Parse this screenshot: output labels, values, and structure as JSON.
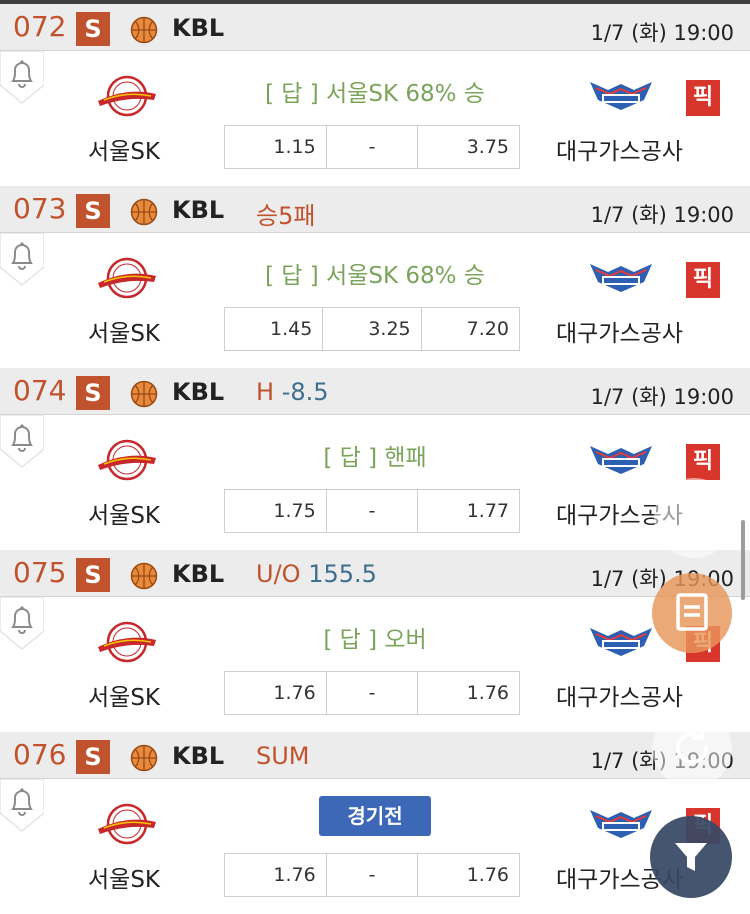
{
  "games": [
    {
      "number": "072",
      "badge": "S",
      "league": "KBL",
      "tag_a": "",
      "tag_b": "",
      "date": "1/7 (화)  19:00",
      "result": "[ 답 ]  서울SK 68% 승",
      "home": "서울SK",
      "away": "대구가스공사",
      "pick": "픽",
      "odds": [
        "1.15",
        "-",
        "3.75"
      ]
    },
    {
      "number": "073",
      "badge": "S",
      "league": "KBL",
      "tag_a": "승5패",
      "tag_b": "",
      "date": "1/7 (화)  19:00",
      "result": "[ 답 ]  서울SK 68% 승",
      "home": "서울SK",
      "away": "대구가스공사",
      "pick": "픽",
      "odds": [
        "1.45",
        "3.25",
        "7.20"
      ]
    },
    {
      "number": "074",
      "badge": "S",
      "league": "KBL",
      "tag_a": "H",
      "tag_b": "-8.5",
      "date": "1/7 (화)  19:00",
      "result": "[ 답 ] 핸패",
      "home": "서울SK",
      "away": "대구가스공사",
      "pick": "픽",
      "odds": [
        "1.75",
        "-",
        "1.77"
      ]
    },
    {
      "number": "075",
      "badge": "S",
      "league": "KBL",
      "tag_a": "U/O",
      "tag_b": "155.5",
      "date": "1/7 (화)  19:00",
      "result": "[ 답 ] 오버",
      "home": "서울SK",
      "away": "대구가스공사",
      "pick": "픽",
      "odds": [
        "1.76",
        "-",
        "1.76"
      ]
    },
    {
      "number": "076",
      "badge": "S",
      "league": "KBL",
      "tag_a": "SUM",
      "tag_b": "",
      "date": "1/7 (화)  19:00",
      "button": "경기전",
      "home": "서울SK",
      "away": "대구가스공사",
      "pick": "픽",
      "odds": [
        "1.76",
        "-",
        "1.76"
      ]
    }
  ],
  "colors": {
    "accent": "#c0532d",
    "answer": "#7aa45a",
    "button": "#3d68b8",
    "pick": "#d8362c",
    "blueText": "#3d6f8e"
  },
  "icons": {
    "sport": "basketball-icon",
    "alarm": "bell-icon",
    "fab_up": "chevron-up-icon",
    "fab_list": "list-icon",
    "fab_refresh": "refresh-icon",
    "fab_filter": "filter-icon"
  }
}
